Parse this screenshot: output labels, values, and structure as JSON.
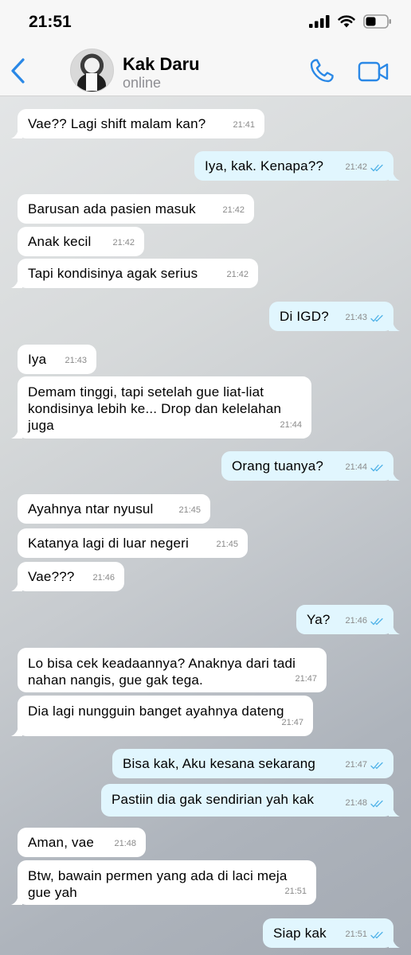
{
  "status_bar": {
    "time": "21:51"
  },
  "header": {
    "contact_name": "Kak Daru",
    "contact_status": "online"
  },
  "colors": {
    "accent": "#2a88e6",
    "incoming_bubble": "#ffffff",
    "outgoing_bubble": "#e1f6fe",
    "read_tick": "#4fb2e8"
  },
  "icons": [
    "signal-icon",
    "wifi-icon",
    "battery-icon",
    "back-chevron-icon",
    "phone-icon",
    "video-camera-icon",
    "double-check-icon"
  ],
  "messages": [
    {
      "dir": "in",
      "text": "Vae?? Lagi shift malam kan?",
      "time": "21:41"
    },
    {
      "dir": "out",
      "text": "Iya, kak. Kenapa??",
      "time": "21:42"
    },
    {
      "dir": "in",
      "text": "Barusan ada pasien masuk",
      "time": "21:42"
    },
    {
      "dir": "in",
      "text": "Anak kecil",
      "time": "21:42"
    },
    {
      "dir": "in",
      "text": "Tapi kondisinya agak serius",
      "time": "21:42"
    },
    {
      "dir": "out",
      "text": "Di IGD?",
      "time": "21:43"
    },
    {
      "dir": "in",
      "text": "Iya",
      "time": "21:43"
    },
    {
      "dir": "in",
      "text": "Demam tinggi, tapi setelah gue liat-liat kondisinya lebih ke... Drop dan kelelahan juga",
      "time": "21:44"
    },
    {
      "dir": "out",
      "text": "Orang tuanya?",
      "time": "21:44"
    },
    {
      "dir": "in",
      "text": "Ayahnya ntar nyusul",
      "time": "21:45"
    },
    {
      "dir": "in",
      "text": "Katanya lagi di luar negeri",
      "time": "21:45"
    },
    {
      "dir": "in",
      "text": "Vae???",
      "time": "21:46"
    },
    {
      "dir": "out",
      "text": "Ya?",
      "time": "21:46"
    },
    {
      "dir": "in",
      "text": "Lo bisa cek keadaannya? Anaknya dari tadi nahan nangis, gue gak tega.",
      "time": "21:47"
    },
    {
      "dir": "in",
      "text": "Dia lagi nungguin banget ayahnya dateng",
      "time": "21:47"
    },
    {
      "dir": "out",
      "text": "Bisa kak, Aku kesana sekarang",
      "time": "21:47"
    },
    {
      "dir": "out",
      "text": "Pastiin dia gak sendirian yah kak",
      "time": "21:48"
    },
    {
      "dir": "in",
      "text": "Aman, vae",
      "time": "21:48"
    },
    {
      "dir": "in",
      "text": "Btw, bawain permen yang ada di laci meja gue yah",
      "time": "21:51"
    },
    {
      "dir": "out",
      "text": "Siap kak",
      "time": "21:51"
    }
  ]
}
